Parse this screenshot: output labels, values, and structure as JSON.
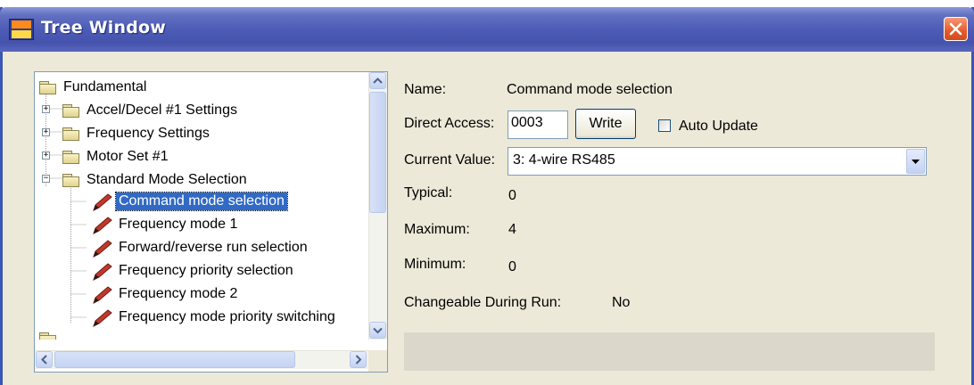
{
  "window": {
    "title": "Tree Window"
  },
  "tree": {
    "root": "Fundamental",
    "groups": [
      {
        "label": "Accel/Decel #1 Settings",
        "expander": "+"
      },
      {
        "label": "Frequency Settings",
        "expander": "+"
      },
      {
        "label": "Motor Set #1",
        "expander": "+"
      },
      {
        "label": "Standard Mode Selection",
        "expander": "−"
      }
    ],
    "items": [
      {
        "label": "Command mode selection",
        "selected": true
      },
      {
        "label": "Frequency mode 1"
      },
      {
        "label": "Forward/reverse run selection"
      },
      {
        "label": "Frequency priority selection"
      },
      {
        "label": "Frequency mode 2"
      },
      {
        "label": "Frequency mode priority switching"
      }
    ]
  },
  "details": {
    "name_label": "Name:",
    "name_value": "Command mode selection",
    "direct_access_label": "Direct Access:",
    "direct_access_value": "0003",
    "write_button": "Write",
    "auto_update_label": "Auto Update",
    "auto_update_checked": false,
    "current_value_label": "Current Value:",
    "current_value": "3: 4-wire RS485",
    "typical_label": "Typical:",
    "typical_value": "0",
    "maximum_label": "Maximum:",
    "maximum_value": "4",
    "minimum_label": "Minimum:",
    "minimum_value": "0",
    "changeable_label": "Changeable During Run:",
    "changeable_value": "No"
  },
  "colors": {
    "titlebar": "#4d5cb6",
    "selection": "#316ac5",
    "close_button": "#e55a2a",
    "pencil": "#c0392b"
  }
}
